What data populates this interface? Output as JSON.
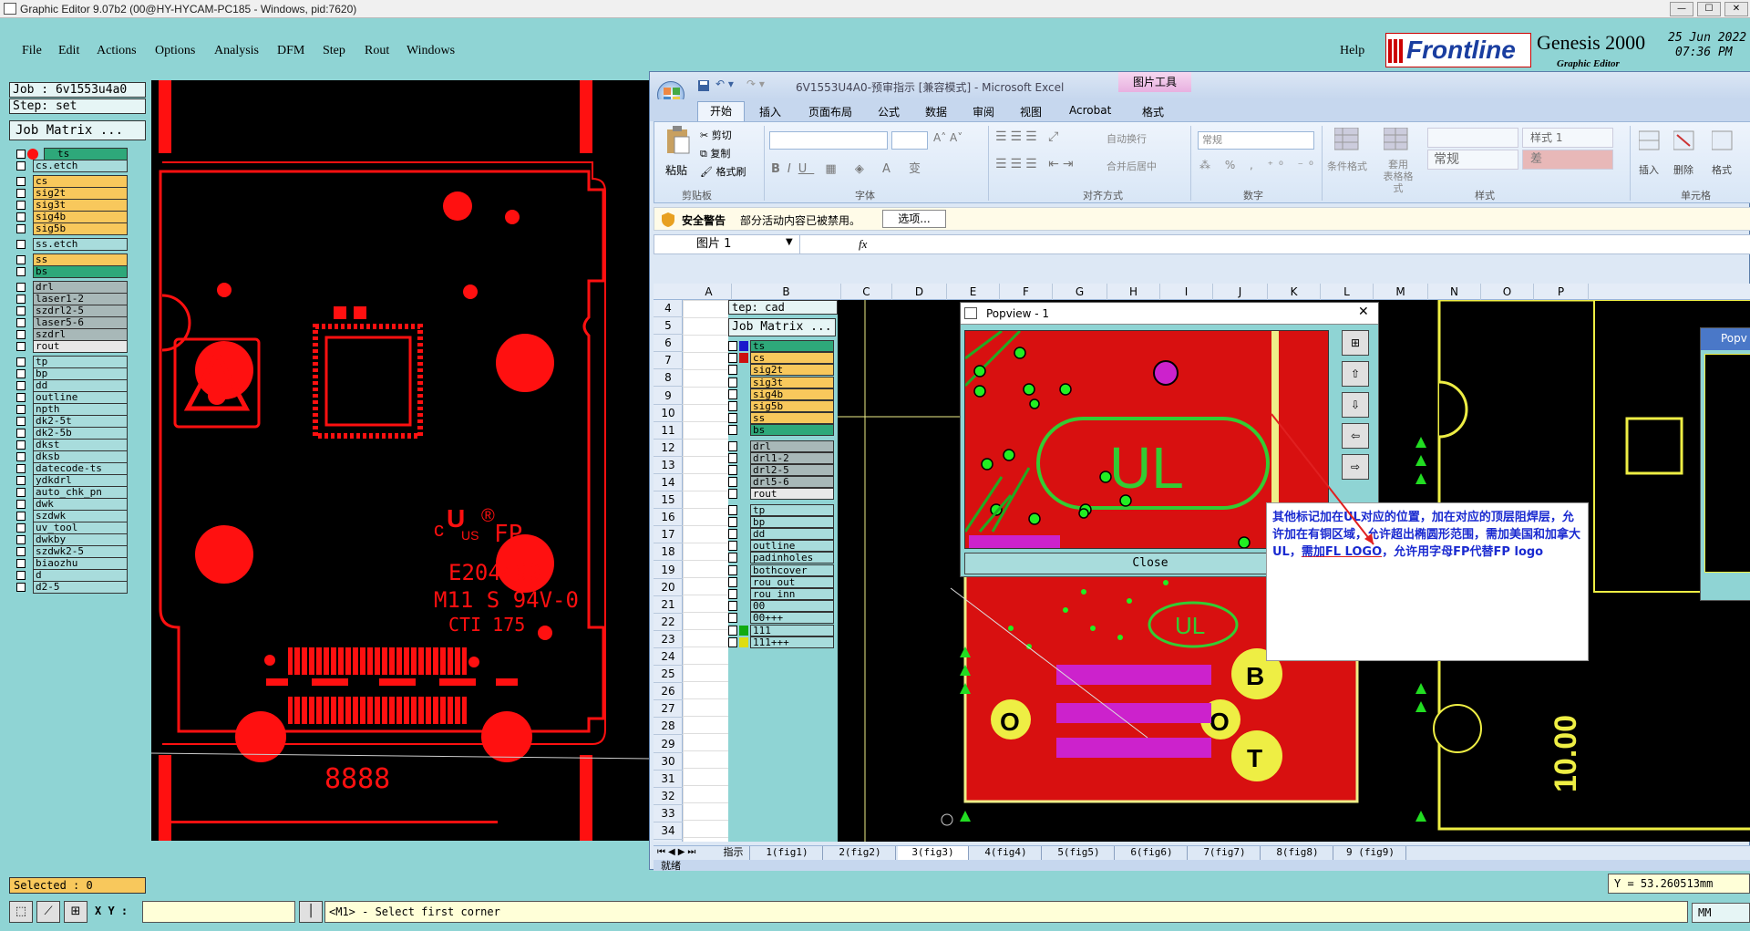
{
  "window": {
    "title": "Graphic Editor 9.07b2 (00@HY-HYCAM-PC185 - Windows, pid:7620)",
    "min": "—",
    "max": "☐",
    "close": "✕"
  },
  "menu": {
    "items": [
      "File",
      "Edit",
      "Actions",
      "Options",
      "Analysis",
      "DFM",
      "Step",
      "Rout",
      "Windows"
    ],
    "help": "Help"
  },
  "brand": {
    "logo": "Frontline",
    "product": "Genesis 2000",
    "subtitle": "Graphic Editor",
    "date": "25 Jun 2022",
    "time": "07:36 PM"
  },
  "job": {
    "job": "Job : 6v1553u4a0",
    "step": "Step: set",
    "matrix": "Job Matrix ..."
  },
  "layers": [
    {
      "name": "ts",
      "color": "teal",
      "group": 0
    },
    {
      "name": "cs.etch",
      "color": "lt",
      "group": 0
    },
    {
      "name": "cs",
      "color": "orange",
      "group": 1
    },
    {
      "name": "sig2t",
      "color": "orange",
      "group": 1
    },
    {
      "name": "sig3t",
      "color": "orange",
      "group": 1
    },
    {
      "name": "sig4b",
      "color": "orange",
      "group": 1
    },
    {
      "name": "sig5b",
      "color": "orange",
      "group": 1
    },
    {
      "name": "ss.etch",
      "color": "lt",
      "group": 2
    },
    {
      "name": "ss",
      "color": "orange",
      "group": 3
    },
    {
      "name": "bs",
      "color": "teal",
      "group": 3
    },
    {
      "name": "drl",
      "color": "grey",
      "group": 4
    },
    {
      "name": "laser1-2",
      "color": "grey",
      "group": 4
    },
    {
      "name": "szdrl2-5",
      "color": "grey",
      "group": 4
    },
    {
      "name": "laser5-6",
      "color": "grey",
      "group": 4
    },
    {
      "name": "szdrl",
      "color": "grey",
      "group": 4
    },
    {
      "name": "rout",
      "color": "wh",
      "group": 4
    },
    {
      "name": "tp",
      "color": "lt",
      "group": 5
    },
    {
      "name": "bp",
      "color": "lt",
      "group": 5
    },
    {
      "name": "dd",
      "color": "lt",
      "group": 5
    },
    {
      "name": "outline",
      "color": "lt",
      "group": 5
    },
    {
      "name": "npth",
      "color": "lt",
      "group": 5
    },
    {
      "name": "dk2-5t",
      "color": "lt",
      "group": 5
    },
    {
      "name": "dk2-5b",
      "color": "lt",
      "group": 5
    },
    {
      "name": "dkst",
      "color": "lt",
      "group": 5
    },
    {
      "name": "dksb",
      "color": "lt",
      "group": 5
    },
    {
      "name": "datecode-ts",
      "color": "lt",
      "group": 5
    },
    {
      "name": "ydkdrl",
      "color": "lt",
      "group": 5
    },
    {
      "name": "auto_chk_pn",
      "color": "lt",
      "group": 5
    },
    {
      "name": "dwk",
      "color": "lt",
      "group": 5
    },
    {
      "name": "szdwk",
      "color": "lt",
      "group": 5
    },
    {
      "name": "uv_tool",
      "color": "lt",
      "group": 5
    },
    {
      "name": "dwkby",
      "color": "lt",
      "group": 5
    },
    {
      "name": "szdwk2-5",
      "color": "lt",
      "group": 5
    },
    {
      "name": "biaozhu",
      "color": "lt",
      "group": 5
    },
    {
      "name": "d",
      "color": "lt",
      "group": 5
    },
    {
      "name": "d2-5",
      "color": "lt",
      "group": 5
    }
  ],
  "pcb": {
    "ul_mark": "c",
    "ul_r": "®",
    "ul_us": "US",
    "fp": "FP",
    "e_number": "E204460",
    "rating": "M11 S 94V-0",
    "cti": "CTI  175",
    "datecode": "8888"
  },
  "status": {
    "selected": "Selected : 0",
    "xy_label": "X Y :",
    "prompt": "<M1> - Select first corner",
    "y_coord": "Y = 53.260513mm",
    "units": "MM"
  },
  "excel": {
    "title": "6V1553U4A0-预审指示  [兼容模式] - Microsoft Excel",
    "context_tab": "图片工具",
    "tabs": [
      "开始",
      "插入",
      "页面布局",
      "公式",
      "数据",
      "审阅",
      "视图",
      "Acrobat",
      "格式"
    ],
    "clipboard": {
      "paste": "粘贴",
      "cut": "剪切",
      "copy": "复制",
      "format_painter": "格式刷",
      "group": "剪贴板"
    },
    "font_group": "字体",
    "align_group": "对齐方式",
    "wrap": "自动换行",
    "merge": "合并后居中",
    "number_group": "数字",
    "number_format": "常规",
    "styles_group": "样式",
    "cond_fmt": "条件格式",
    "table_fmt": "套用\n表格格式",
    "style1": "样式 1",
    "normal": "常规",
    "bad": "差",
    "cells_group": "单元格",
    "insert": "插入",
    "delete": "删除",
    "format": "格式",
    "security_label": "安全警告",
    "security_msg": "部分活动内容已被禁用。",
    "options_btn": "选项...",
    "name_box": "图片 1",
    "fx": "fx",
    "col_headers": [
      "A",
      "B",
      "C",
      "D",
      "E",
      "F",
      "G",
      "H",
      "I",
      "J",
      "K",
      "L",
      "M",
      "N",
      "O",
      "P"
    ],
    "row_headers": [
      "4",
      "5",
      "6",
      "7",
      "8",
      "9",
      "10",
      "11",
      "12",
      "13",
      "14",
      "15",
      "16",
      "17",
      "18",
      "19",
      "20",
      "21",
      "22",
      "23",
      "24",
      "25",
      "26",
      "27",
      "28",
      "29",
      "30",
      "31",
      "32",
      "33",
      "34"
    ],
    "sheet_tabs": [
      "指示",
      "1(fig1)",
      "2(fig2)",
      "3(fig3)",
      "4(fig4)",
      "5(fig5)",
      "6(fig6)",
      "7(fig7)",
      "8(fig8)",
      "9 (fig9)"
    ],
    "ready": "就绪"
  },
  "embedded": {
    "step": "tep: cad",
    "matrix": "Job Matrix ...",
    "layers": [
      {
        "name": "ts",
        "color": "teal",
        "sw": "#1a1acc"
      },
      {
        "name": "cs",
        "color": "orange",
        "sw": "#cc1111"
      },
      {
        "name": "sig2t",
        "color": "orange",
        "sw": ""
      },
      {
        "name": "sig3t",
        "color": "orange",
        "sw": ""
      },
      {
        "name": "sig4b",
        "color": "orange",
        "sw": ""
      },
      {
        "name": "sig5b",
        "color": "orange",
        "sw": ""
      },
      {
        "name": "ss",
        "color": "orange",
        "sw": ""
      },
      {
        "name": "bs",
        "color": "teal",
        "sw": ""
      },
      {
        "name": "drl",
        "color": "grey",
        "sw": ""
      },
      {
        "name": "drl1-2",
        "color": "grey",
        "sw": ""
      },
      {
        "name": "drl2-5",
        "color": "grey",
        "sw": ""
      },
      {
        "name": "drl5-6",
        "color": "grey",
        "sw": ""
      },
      {
        "name": "rout",
        "color": "wh",
        "sw": ""
      },
      {
        "name": "tp",
        "color": "lt",
        "sw": ""
      },
      {
        "name": "bp",
        "color": "lt",
        "sw": ""
      },
      {
        "name": "dd",
        "color": "lt",
        "sw": ""
      },
      {
        "name": "outline",
        "color": "lt",
        "sw": ""
      },
      {
        "name": "padinholes",
        "color": "lt",
        "sw": ""
      },
      {
        "name": "bothcover",
        "color": "lt",
        "sw": ""
      },
      {
        "name": "rou_out",
        "color": "lt",
        "sw": ""
      },
      {
        "name": "rou_inn",
        "color": "lt",
        "sw": ""
      },
      {
        "name": "00",
        "color": "lt",
        "sw": ""
      },
      {
        "name": "00+++",
        "color": "lt",
        "sw": ""
      },
      {
        "name": "111",
        "color": "lt",
        "sw": "#11aa11"
      },
      {
        "name": "111+++",
        "color": "lt",
        "sw": "#dddd11"
      }
    ]
  },
  "popview": {
    "title": "Popview - 1",
    "title2": "Popv",
    "close": "Close",
    "ul": "UL",
    "o": "O",
    "b": "B",
    "t": "T",
    "tall": "10.00"
  },
  "annotation": {
    "text_a": "其他标记加在UL对应的位置，加在对应的顶层阻焊层，允许加在有铜区域，允许超出椭圆形范围，需加美国和加拿大UL，",
    "text_b": "需加FL LOGO",
    "text_c": "，允许用字母FP代替FP logo"
  }
}
